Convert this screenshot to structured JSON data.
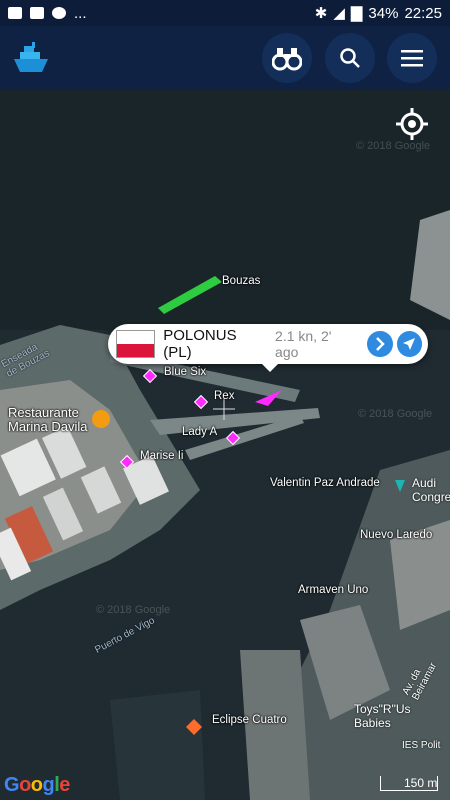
{
  "status_bar": {
    "left_icons": [
      "notification-icon",
      "image-icon",
      "whatsapp-icon"
    ],
    "ellipsis": "...",
    "battery": "34%",
    "time": "22:25"
  },
  "header": {
    "buttons": [
      "binoculars-icon",
      "search-icon",
      "menu-icon"
    ]
  },
  "popup": {
    "flag": "PL",
    "name": "POLONUS (PL)",
    "info": "2.1 kn, 2' ago"
  },
  "vessels": [
    {
      "name": "Bouzas"
    },
    {
      "name": "Blue Six"
    },
    {
      "name": "Rex"
    },
    {
      "name": "Lady A"
    },
    {
      "name": "Marise Ii"
    },
    {
      "name": "Valentin Paz Andrade"
    },
    {
      "name": "Nuevo Laredo"
    },
    {
      "name": "Armaven Uno"
    },
    {
      "name": "Eclipse Cuatro"
    }
  ],
  "places": {
    "restaurant": "Restaurante\nMarina Davila",
    "ensenada": "Enseada\nde Bouzas",
    "puerto": "Puerto de Vigo",
    "audi": "Audi\nCongresos",
    "toys": "Toys\"R\"Us Babies",
    "street": "Av. da Beiramar",
    "ies": "IES Polit",
    "copyright1": "© 2018 Google",
    "copyright2": "© 2018 Google",
    "copyright3": "© 2018 Google"
  },
  "map": {
    "scale": "150 m",
    "brand": "Google"
  },
  "colors": {
    "statusbar": "#0d1c38",
    "appbar": "#0f2244",
    "vessel_marker": "#ff2aff",
    "ship_highlight": "#2ecc40",
    "popup_accent": "#2f8be0"
  }
}
